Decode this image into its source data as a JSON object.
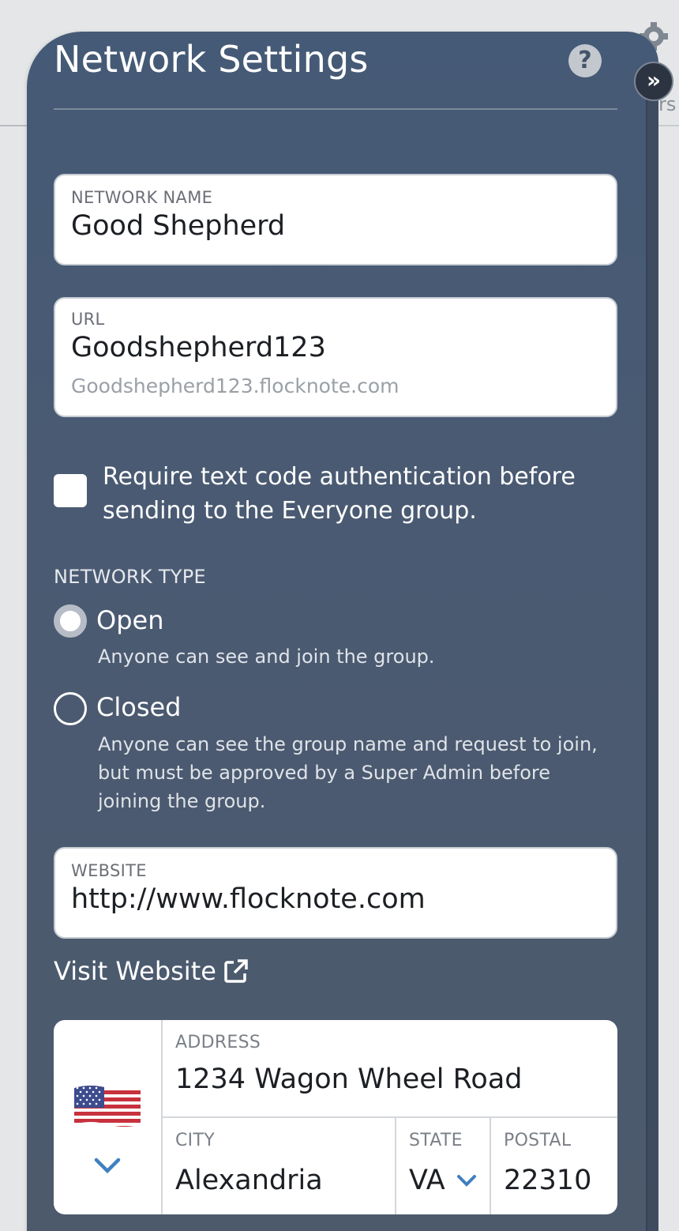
{
  "panel": {
    "title": "Network Settings",
    "help_icon": "question-circle-icon",
    "collapse_icon": "double-chevron-right-icon"
  },
  "background": {
    "partial_text": "rs"
  },
  "fields": {
    "network_name": {
      "label": "NETWORK NAME",
      "value": "Good Shepherd"
    },
    "url": {
      "label": "URL",
      "value": "Goodshepherd123",
      "hint": "Goodshepherd123.flocknote.com"
    },
    "website": {
      "label": "WEBSITE",
      "value": "http://www.flocknote.com"
    }
  },
  "text_auth": {
    "checked": false,
    "label": "Require text code authentication before sending to the Everyone group."
  },
  "network_type": {
    "label": "NETWORK TYPE",
    "selected": "Open",
    "options": [
      {
        "title": "Open",
        "description": "Anyone can see and join the group."
      },
      {
        "title": "Closed",
        "description": "Anyone can see the group name and request to join, but must be approved by a Super Admin before joining the group."
      }
    ]
  },
  "visit_website": {
    "label": "Visit Website",
    "icon": "external-link-icon"
  },
  "address": {
    "country_icon": "us-flag-icon",
    "address_label": "ADDRESS",
    "address_value": "1234 Wagon Wheel Road",
    "city_label": "CITY",
    "city_value": "Alexandria",
    "state_label": "STATE",
    "state_value": "VA",
    "postal_label": "POSTAL",
    "postal_value": "22310"
  },
  "colors": {
    "panel": "#4a5a72",
    "text": "#ffffff",
    "chevron": "#3f7fc1"
  }
}
